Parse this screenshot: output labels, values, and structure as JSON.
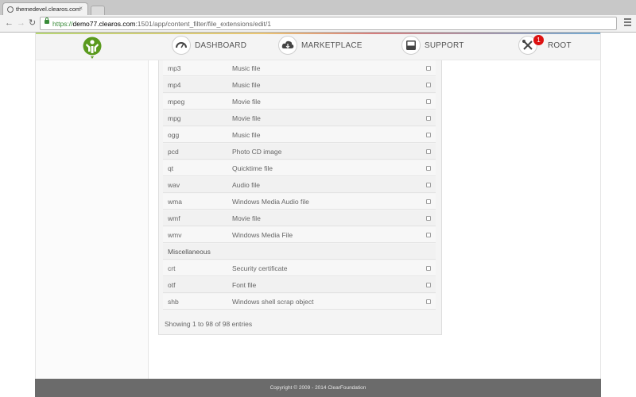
{
  "browser": {
    "tab_title": "themedevel.clearos.com",
    "tab_close": "×",
    "url_scheme": "https://",
    "url_domain": "demo77.clearos.com",
    "url_path": ":1501/app/content_filter/file_extensions/edit/1"
  },
  "header": {
    "nav": [
      {
        "label": "DASHBOARD",
        "icon": "dashboard-gauge-icon"
      },
      {
        "label": "MARKETPLACE",
        "icon": "cloud-download-icon"
      },
      {
        "label": "SUPPORT",
        "icon": "support-box-icon"
      },
      {
        "label": "ROOT",
        "icon": "tools-icon"
      }
    ],
    "notification_count": "1",
    "logo_icon": "clearos-logo-icon"
  },
  "table": {
    "rows": [
      {
        "ext": "mp3",
        "desc": "Music file",
        "checked": false
      },
      {
        "ext": "mp4",
        "desc": "Music file",
        "checked": false
      },
      {
        "ext": "mpeg",
        "desc": "Movie file",
        "checked": false
      },
      {
        "ext": "mpg",
        "desc": "Movie file",
        "checked": false
      },
      {
        "ext": "ogg",
        "desc": "Music file",
        "checked": false
      },
      {
        "ext": "pcd",
        "desc": "Photo CD image",
        "checked": false
      },
      {
        "ext": "qt",
        "desc": "Quicktime file",
        "checked": false
      },
      {
        "ext": "wav",
        "desc": "Audio file",
        "checked": false
      },
      {
        "ext": "wma",
        "desc": "Windows Media Audio file",
        "checked": false
      },
      {
        "ext": "wmf",
        "desc": "Movie file",
        "checked": false
      },
      {
        "ext": "wmv",
        "desc": "Windows Media File",
        "checked": false
      }
    ],
    "group_label": "Miscellaneous",
    "misc_rows": [
      {
        "ext": "crt",
        "desc": "Security certificate",
        "checked": false
      },
      {
        "ext": "otf",
        "desc": "Font file",
        "checked": false
      },
      {
        "ext": "shb",
        "desc": "Windows shell scrap object",
        "checked": false
      }
    ],
    "entries_info": "Showing 1 to 98 of 98 entries"
  },
  "footer": {
    "copyright": "Copyright © 2009 - 2014 ClearFoundation"
  },
  "colors": {
    "logo_green": "#5a9a1e",
    "badge_red": "#dd1111",
    "footer_bg": "#6b6b6b"
  }
}
